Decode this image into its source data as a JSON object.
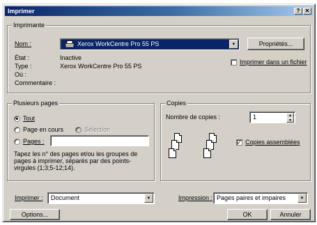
{
  "window": {
    "title": "Imprimer",
    "help_glyph": "?",
    "close_glyph": "✕"
  },
  "printer": {
    "group_label": "Imprimante",
    "name_label": "Nom :",
    "name_value": "Xerox WorkCentre Pro 55 PS",
    "properties_button": "Propriétés...",
    "status_label": "État :",
    "status_value": "Inactive",
    "type_label": "Type :",
    "type_value": "Xerox WorkCentre Pro 55 PS",
    "where_label": "Où :",
    "comment_label": "Commentaire :",
    "print_to_file_label": "Imprimer dans un fichier",
    "print_to_file_checked": false
  },
  "range": {
    "group_label": "Plusieurs pages",
    "all_label": "Tout",
    "current_page_label": "Page en cours",
    "selection_label": "Sélection",
    "pages_label": "Pages :",
    "pages_value": "",
    "hint": "Tapez les n° des pages et/ou les groupes de pages à imprimer, séparés par des points-virgules (1;3;5-12;14).",
    "selected": "all"
  },
  "copies": {
    "group_label": "Copies",
    "count_label": "Nombre de copies :",
    "count_value": "1",
    "collate_label": "Copies assemblées",
    "collate_checked": true
  },
  "bottom": {
    "print_what_label": "Imprimer :",
    "print_what_value": "Document",
    "print_only_label": "Impression :",
    "print_only_value": "Pages paires et impaires",
    "options_button": "Options...",
    "ok_button": "OK",
    "cancel_button": "Annuler"
  }
}
